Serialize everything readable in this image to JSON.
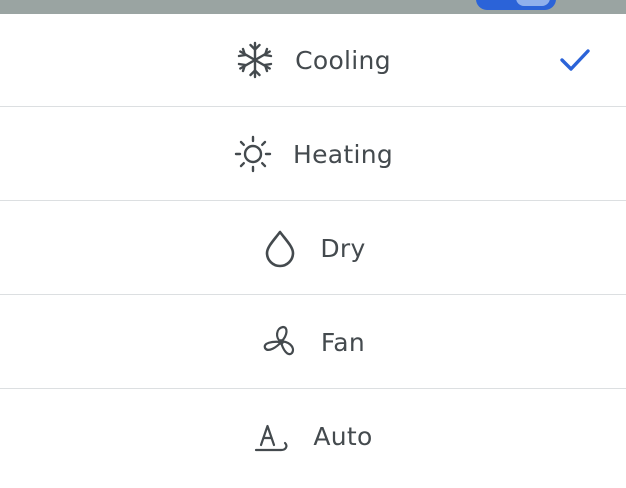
{
  "accent_color": "#2b63d8",
  "text_color": "#444a4e",
  "selected_mode": "Cooling",
  "modes": [
    {
      "label": "Cooling",
      "icon": "snowflake-icon",
      "selected": true
    },
    {
      "label": "Heating",
      "icon": "sun-icon",
      "selected": false
    },
    {
      "label": "Dry",
      "icon": "droplet-icon",
      "selected": false
    },
    {
      "label": "Fan",
      "icon": "fan-icon",
      "selected": false
    },
    {
      "label": "Auto",
      "icon": "auto-icon",
      "selected": false
    }
  ]
}
